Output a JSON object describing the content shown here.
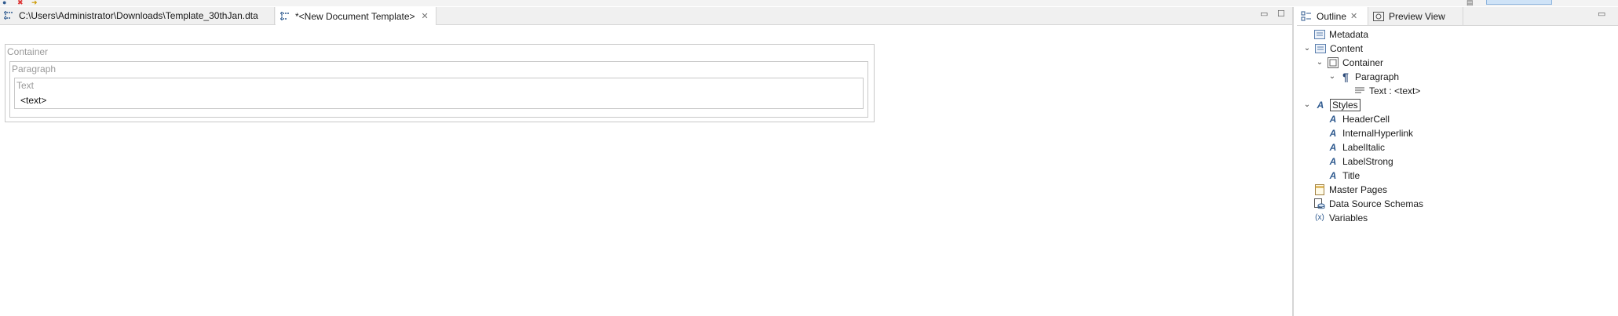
{
  "editor": {
    "tabs": [
      {
        "label": "C:\\Users\\Administrator\\Downloads\\Template_30thJan.dta"
      },
      {
        "label": "*<New Document Template>"
      }
    ],
    "minimize": "▭",
    "maximize": "☐"
  },
  "canvas": {
    "container_label": "Container",
    "paragraph_label": "Paragraph",
    "text_label": "Text",
    "text_value": "<text>"
  },
  "outline": {
    "tabs": [
      {
        "label": "Outline"
      },
      {
        "label": "Preview View"
      }
    ],
    "minimize": "▭",
    "tree": [
      {
        "label": "Metadata",
        "icon": "metadata-icon"
      },
      {
        "label": "Content",
        "icon": "content-icon",
        "expanded": true
      },
      {
        "label": "Container",
        "icon": "container-icon",
        "expanded": true
      },
      {
        "label": "Paragraph",
        "icon": "paragraph-icon",
        "expanded": true
      },
      {
        "label": "Text : <text>",
        "icon": "text-icon"
      },
      {
        "label": "Styles",
        "icon": "style-icon",
        "expanded": true,
        "selected": true
      },
      {
        "label": "HeaderCell",
        "icon": "style-icon"
      },
      {
        "label": "InternalHyperlink",
        "icon": "style-icon"
      },
      {
        "label": "LabelItalic",
        "icon": "style-icon"
      },
      {
        "label": "LabelStrong",
        "icon": "style-icon"
      },
      {
        "label": "Title",
        "icon": "style-icon"
      },
      {
        "label": "Master Pages",
        "icon": "master-pages-icon"
      },
      {
        "label": "Data Source Schemas",
        "icon": "data-source-icon"
      },
      {
        "label": "Variables",
        "icon": "variables-icon"
      }
    ]
  },
  "colors": {
    "accent": "#2f5a8f",
    "selection_border": "#444444",
    "perspective_active": "#cfe3f7"
  }
}
